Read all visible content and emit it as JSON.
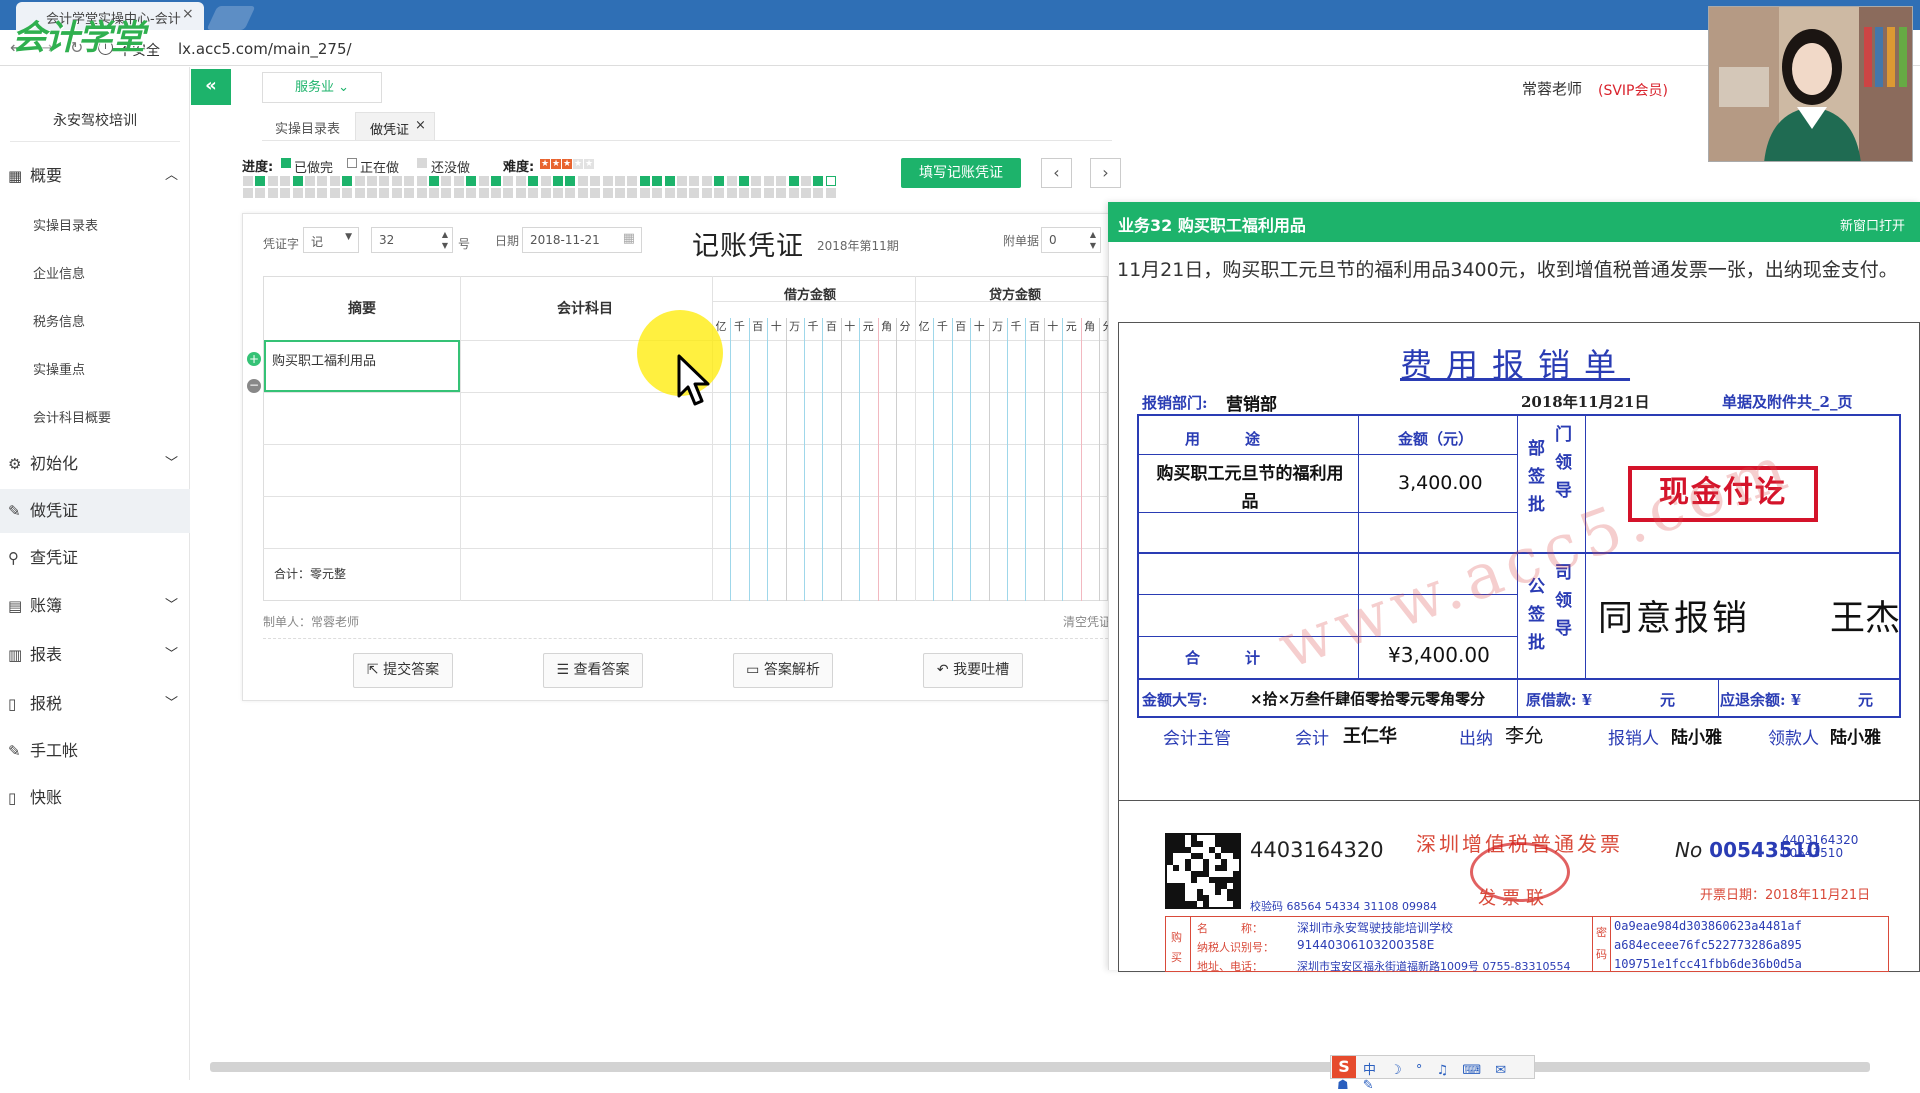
{
  "browser": {
    "tab_title": "会计学堂实操中心-会计",
    "tab_close": "×",
    "insecure_label": "不安全",
    "url": "lx.acc5.com/main_275/",
    "logo_text": "会计学堂"
  },
  "sidebar": {
    "school": "永安驾校培训",
    "items": [
      {
        "label": "概要",
        "icon": "grid-icon",
        "chevron": "^"
      },
      {
        "label": "初始化",
        "icon": "gear-icon",
        "chevron": "v"
      },
      {
        "label": "做凭证",
        "icon": "pen-icon"
      },
      {
        "label": "查凭证",
        "icon": "search-icon"
      },
      {
        "label": "账簿",
        "icon": "book-icon",
        "chevron": "v"
      },
      {
        "label": "报表",
        "icon": "report-icon",
        "chevron": "v"
      },
      {
        "label": "报税",
        "icon": "file-icon",
        "chevron": "v"
      },
      {
        "label": "手工帐",
        "icon": "pen-icon"
      },
      {
        "label": "快账",
        "icon": "file-icon"
      }
    ],
    "sub_items": [
      "实操目录表",
      "企业信息",
      "税务信息",
      "实操重点",
      "会计科目概要"
    ]
  },
  "header": {
    "collapse": "«",
    "industry": "服务业 ⌄",
    "teacher": "常蓉老师",
    "vip": "(SVIP会员)"
  },
  "subtabs": {
    "catalog": "实操目录表",
    "voucher": "做凭证",
    "close": "×"
  },
  "progress": {
    "label": "进度:",
    "done": "已做完",
    "doing": "正在做",
    "todo": "还没做",
    "difficulty_label": "难度:",
    "difficulty_stars": 3,
    "difficulty_max": 5,
    "colors": {
      "done": "#1db36b",
      "doing": "#ffffff",
      "todo": "#d8d8d8"
    }
  },
  "actions": {
    "fill": "填写记账凭证",
    "prev": "‹",
    "next": "›"
  },
  "voucher": {
    "word_label": "凭证字",
    "word_value": "记",
    "number": "32",
    "hao": "号",
    "date_label": "日期",
    "date": "2018-11-21",
    "title": "记账凭证",
    "period": "2018年第11期",
    "attach_label": "附单据",
    "attach_value": "0",
    "col_summary": "摘要",
    "col_account": "会计科目",
    "col_debit": "借方金额",
    "col_credit": "贷方金额",
    "digits": [
      "亿",
      "千",
      "百",
      "十",
      "万",
      "千",
      "百",
      "十",
      "元",
      "角",
      "分"
    ],
    "row1_summary": "购买职工福利用品",
    "total": "合计：零元整",
    "maker": "制单人：常蓉老师",
    "clear": "清空凭证"
  },
  "buttons": {
    "submit": "提交答案",
    "view": "查看答案",
    "analysis": "答案解析",
    "feedback": "我要吐槽"
  },
  "panel": {
    "title": "业务32 购买职工福利用品",
    "new_window": "新窗口打开",
    "description": "11月21日，购买职工元旦节的福利用品3400元，收到增值税普通发票一张，出纳现金支付。"
  },
  "reimburse": {
    "title": "费用报销单",
    "dept_label": "报销部门:",
    "dept": "营销部",
    "date": "2018年11月21日",
    "attach": "单据及附件共_2_页",
    "col_use": "用　　　途",
    "col_amount": "金额（元）",
    "dept_sign": [
      "部",
      "门",
      "签",
      "领",
      "批",
      "导"
    ],
    "item": "购买职工元旦节的福利用品",
    "amount": "3,400.00",
    "total_label": "合　　　计",
    "total": "¥3,400.00",
    "company_sign": [
      "公",
      "司",
      "签",
      "领",
      "批",
      "导"
    ],
    "approval": "同意报销",
    "approver": "王杰",
    "stamp": "现金付讫",
    "watermark": "www.acc5.com",
    "capital_label": "金额大写:",
    "capital": "×拾×万叁仟肆佰零拾零元零角零分",
    "advance_label": "原借款: ¥",
    "advance_unit": "元",
    "refund_label": "应退余额: ¥",
    "refund_unit": "元",
    "sig_supervisor": "会计主管",
    "sig_accountant": "会计",
    "accountant": "王仁华",
    "sig_cashier": "出纳",
    "cashier": "李允",
    "sig_applicant": "报销人",
    "applicant": "陆小雅",
    "sig_receiver": "领款人",
    "receiver": "陆小雅"
  },
  "invoice": {
    "code": "4403164320",
    "title": "深圳增值税普通发票",
    "no_label": "No",
    "no": "00543510",
    "no_small_1": "4403164320",
    "no_small_2": "00543510",
    "date": "开票日期：2018年11月21日",
    "check": "校验码 68564 54334 31108 09984",
    "sub": "发票联",
    "buyer_side": "购买",
    "name_label": "名　　　称：",
    "name": "深圳市永安驾驶技能培训学校",
    "tax_label": "纳税人识别号：",
    "tax_id": "91440306103200358E",
    "addr_label": "地址、电话：",
    "addr": "深圳市宝安区福永街道福新路1009号 0755-83310554",
    "cipher_side": "密码",
    "cipher": [
      "0a9eae984d303860623a4481af",
      "a684eceee76fc522773286a895",
      "109751e1fcc41fbb6de36b0d5a"
    ]
  },
  "ime": {
    "text": "中 ☽ ° ♫ ⌨ ✉ ☗ ✎"
  }
}
